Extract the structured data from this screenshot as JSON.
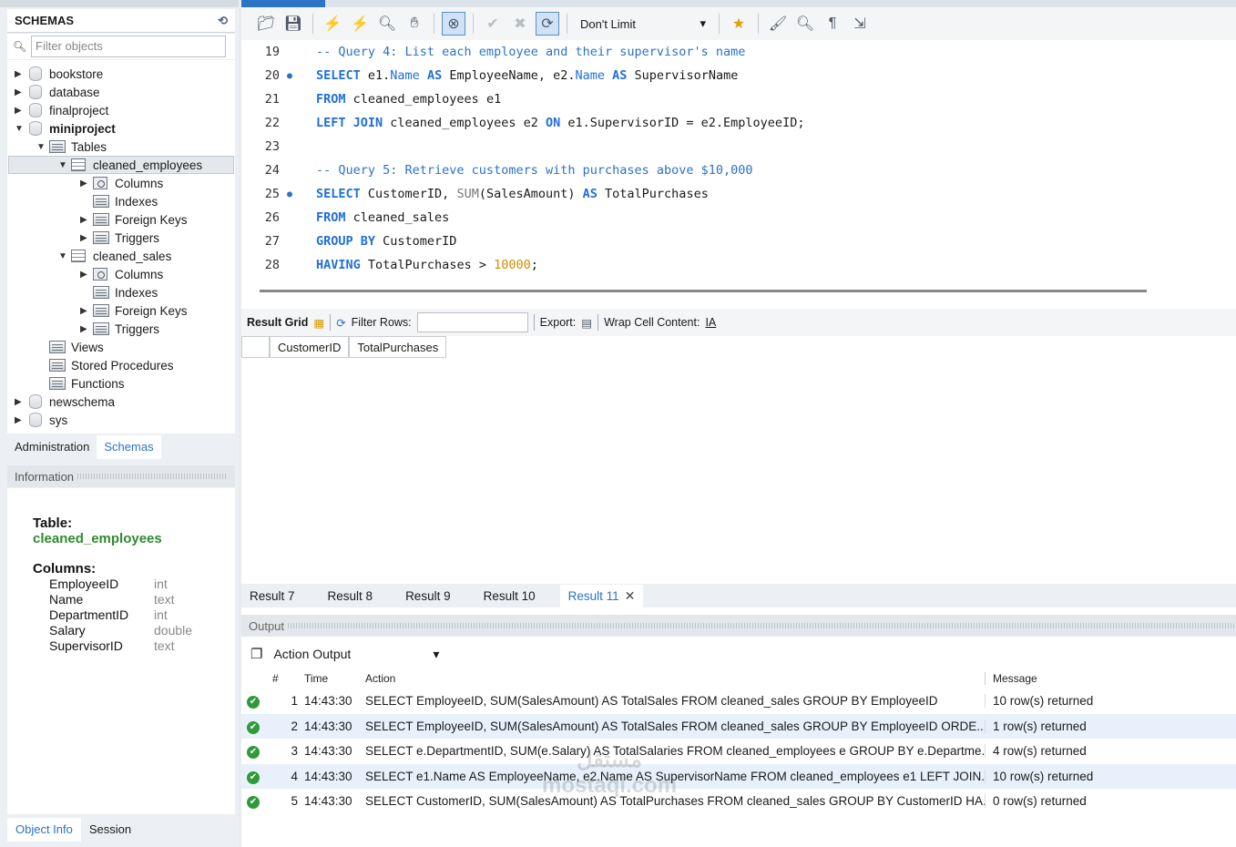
{
  "sidebar": {
    "schemas_title": "SCHEMAS",
    "filter_placeholder": "Filter objects",
    "tree": {
      "bookstore": "bookstore",
      "database": "database",
      "finalproject": "finalproject",
      "miniproject": "miniproject",
      "tables": "Tables",
      "cleaned_employees": "cleaned_employees",
      "columns1": "Columns",
      "indexes1": "Indexes",
      "fkeys1": "Foreign Keys",
      "triggers1": "Triggers",
      "cleaned_sales": "cleaned_sales",
      "columns2": "Columns",
      "indexes2": "Indexes",
      "fkeys2": "Foreign Keys",
      "triggers2": "Triggers",
      "views": "Views",
      "stored_procedures": "Stored Procedures",
      "functions": "Functions",
      "newschema": "newschema",
      "sys": "sys"
    },
    "tabs": {
      "administration": "Administration",
      "schemas": "Schemas"
    },
    "info_title": "Information",
    "info": {
      "table_label": "Table:",
      "table_name": "cleaned_employees",
      "columns_label": "Columns:",
      "columns": [
        {
          "name": "EmployeeID",
          "type": "int"
        },
        {
          "name": "Name",
          "type": "text"
        },
        {
          "name": "DepartmentID",
          "type": "int"
        },
        {
          "name": "Salary",
          "type": "double"
        },
        {
          "name": "SupervisorID",
          "type": "text"
        }
      ]
    },
    "bottom_tabs": {
      "object_info": "Object Info",
      "session": "Session"
    }
  },
  "toolbar": {
    "limit": "Don't Limit"
  },
  "editor": {
    "lines": [
      {
        "n": "19",
        "bp": false
      },
      {
        "n": "20",
        "bp": true
      },
      {
        "n": "21",
        "bp": false
      },
      {
        "n": "22",
        "bp": false
      },
      {
        "n": "23",
        "bp": false
      },
      {
        "n": "24",
        "bp": false
      },
      {
        "n": "25",
        "bp": true
      },
      {
        "n": "26",
        "bp": false
      },
      {
        "n": "27",
        "bp": false
      },
      {
        "n": "28",
        "bp": false
      }
    ],
    "text": {
      "l19": "-- Query 4: List each employee and their supervisor's name",
      "l20_select": "SELECT",
      "l20_a": " e1.",
      "l20_name": "Name",
      "l20_as": " AS",
      "l20_b": " EmployeeName, e2.",
      "l20_name2": "Name",
      "l20_as2": " AS",
      "l20_c": " SupervisorName",
      "l21_from": "FROM",
      "l21_rest": " cleaned_employees e1",
      "l22_left": "LEFT JOIN",
      "l22_a": " cleaned_employees e2 ",
      "l22_on": "ON",
      "l22_b": " e1.SupervisorID = e2.EmployeeID;",
      "l24": "-- Query 5: Retrieve customers with purchases above $10,000",
      "l25_select": "SELECT",
      "l25_a": " CustomerID, ",
      "l25_sum": "SUM",
      "l25_b": "(SalesAmount) ",
      "l25_as": "AS",
      "l25_c": " TotalPurchases",
      "l26_from": "FROM",
      "l26_rest": " cleaned_sales",
      "l27_group": "GROUP BY",
      "l27_rest": " CustomerID",
      "l28_having": "HAVING",
      "l28_a": " TotalPurchases > ",
      "l28_num": "10000",
      "l28_b": ";"
    }
  },
  "result_toolbar": {
    "result_grid": "Result Grid",
    "filter_rows": "Filter Rows:",
    "export": "Export:",
    "wrap": "Wrap Cell Content:"
  },
  "grid": {
    "columns": [
      "CustomerID",
      "TotalPurchases"
    ]
  },
  "result_tabs": [
    "Result 7",
    "Result 8",
    "Result 9",
    "Result 10",
    "Result 11"
  ],
  "output": {
    "title": "Output",
    "action_output": "Action Output",
    "headers": {
      "num": "#",
      "time": "Time",
      "action": "Action",
      "message": "Message"
    },
    "rows": [
      {
        "num": "1",
        "time": "14:43:30",
        "action": "SELECT EmployeeID, SUM(SalesAmount) AS TotalSales FROM cleaned_sales GROUP BY EmployeeID",
        "message": "10 row(s) returned"
      },
      {
        "num": "2",
        "time": "14:43:30",
        "action": "SELECT EmployeeID, SUM(SalesAmount) AS TotalSales FROM cleaned_sales GROUP BY EmployeeID ORDE...",
        "message": "1 row(s) returned"
      },
      {
        "num": "3",
        "time": "14:43:30",
        "action": "SELECT e.DepartmentID, SUM(e.Salary) AS TotalSalaries FROM cleaned_employees e GROUP BY e.Departme...",
        "message": "4 row(s) returned"
      },
      {
        "num": "4",
        "time": "14:43:30",
        "action": "SELECT e1.Name AS EmployeeName, e2.Name AS SupervisorName FROM cleaned_employees e1 LEFT JOIN...",
        "message": "10 row(s) returned"
      },
      {
        "num": "5",
        "time": "14:43:30",
        "action": "SELECT CustomerID, SUM(SalesAmount) AS TotalPurchases FROM cleaned_sales GROUP BY CustomerID HA...",
        "message": "0 row(s) returned"
      }
    ]
  },
  "watermark": {
    "line1": "مستقل",
    "line2": "mostaql.com"
  }
}
